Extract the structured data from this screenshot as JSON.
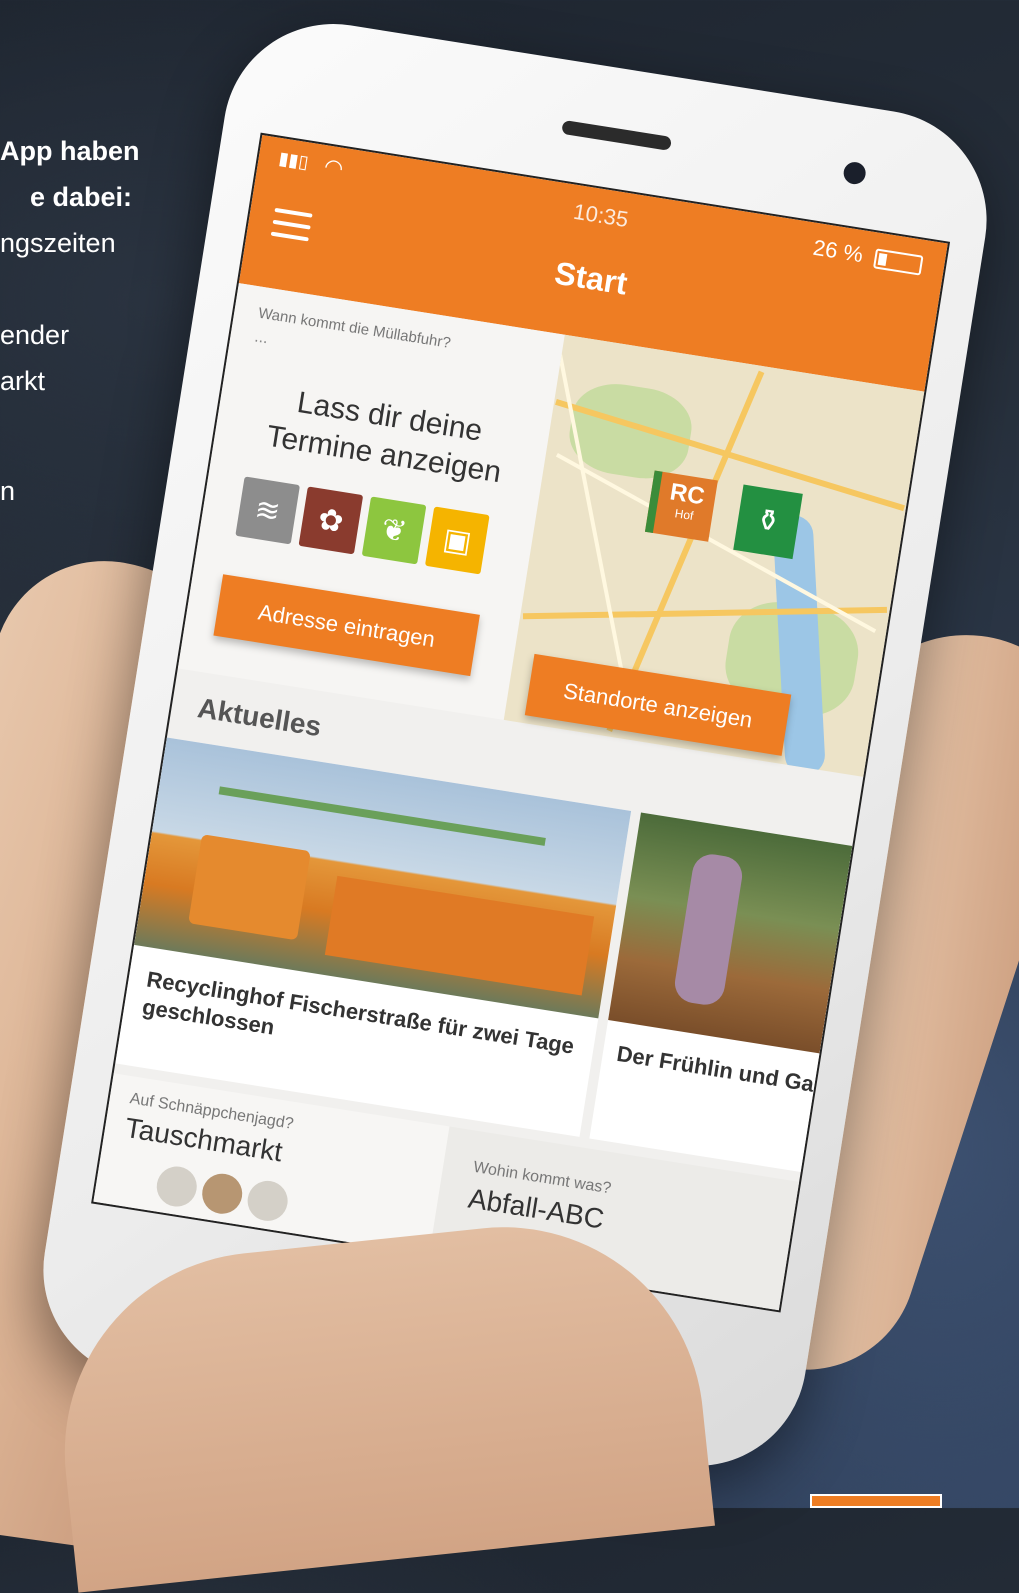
{
  "side_text": {
    "line1": "App haben",
    "line2": "e dabei:",
    "line3": "ngszeiten",
    "line4": "ender",
    "line5": "arkt",
    "line6": "n"
  },
  "status_bar": {
    "time": "10:35",
    "battery": "26 %"
  },
  "nav": {
    "title": "Start"
  },
  "termine": {
    "sub_label": "Wann kommt die Müllabfuhr?",
    "dots": "...",
    "heading": "Lass dir deine Termine anzeigen",
    "button": "Adresse eintragen"
  },
  "map": {
    "pin_rc": "RC",
    "pin_rc_sub": "Hof",
    "button": "Standorte anzeigen"
  },
  "aktuelles": {
    "title": "Aktuelles",
    "items": [
      {
        "title": "Recyclinghof Fischerstraße für zwei Tage geschlossen"
      },
      {
        "title": "Der Frühlin und Garten"
      }
    ]
  },
  "bottom": {
    "tausch_sub": "Auf Schnäppchenjagd?",
    "tausch_title": "Tauschmarkt",
    "abc_sub": "Wohin kommt was?",
    "abc_title": "Abfall-ABC"
  },
  "colors": {
    "accent": "#ee7d23",
    "green": "#239041",
    "bin_grey": "#8d8d8d",
    "bin_brown": "#8a3b2e",
    "bin_green": "#8dc63f",
    "bin_yellow": "#f5b400"
  }
}
